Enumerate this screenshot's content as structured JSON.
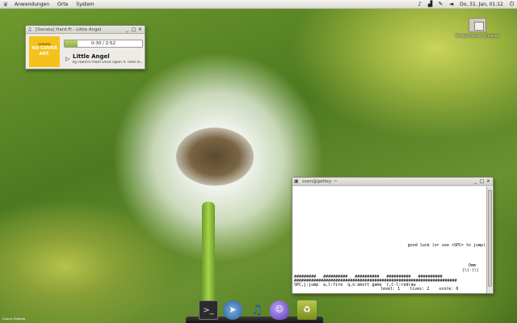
{
  "top_panel": {
    "menus": [
      "Anwendungen",
      "Orte",
      "System"
    ],
    "clock": "Do, 31. Jan, 01:12"
  },
  "desktop": {
    "icons": [
      {
        "label": "Persönlicher Ordner"
      }
    ],
    "corner_label": "Gnome Desktop"
  },
  "sonata": {
    "title": "[Sonata] Hard-Fi - Little Angel",
    "cover_text": "NO COVER ART.",
    "cover_small": "SONATA",
    "progress_text": "0:30 / 2:52",
    "progress_fraction": 0.17,
    "song_title": "Little Angel",
    "song_sub": "by Hard-Fi from Once Upon A Time In..."
  },
  "terminal": {
    "title": "sven@gettsy: ~",
    "lines": {
      "good_luck": "good luck (or use <SPC> to jump)",
      "player_a": "Omm",
      "player_b": "(\\)-(\\)",
      "ground1": "#########   ##########   ##########   ##########   ##########",
      "ground2": "###################################################################",
      "help": "SPC,j:jump  a,l:fire  q,n:abort game  r,C-l:redraw",
      "status": "level: 1    lives: 2    score: 0"
    }
  },
  "dock": {
    "items": [
      "terminal",
      "web-browser",
      "music-player",
      "chat-client",
      "trash"
    ]
  }
}
